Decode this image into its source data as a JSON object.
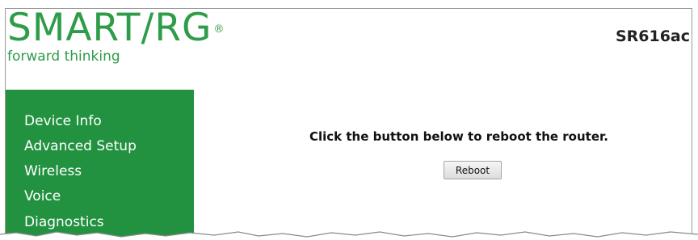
{
  "header": {
    "logo_text": "SMART/RG",
    "tagline": "forward thinking",
    "model": "SR616ac"
  },
  "sidebar": {
    "items": [
      {
        "label": "Device Info"
      },
      {
        "label": "Advanced Setup"
      },
      {
        "label": "Wireless"
      },
      {
        "label": "Voice"
      },
      {
        "label": "Diagnostics"
      }
    ]
  },
  "main": {
    "message": "Click the button below to reboot the router.",
    "reboot_button": "Reboot"
  },
  "colors": {
    "brand_green": "#2e9c48",
    "sidebar_green": "#229240"
  }
}
